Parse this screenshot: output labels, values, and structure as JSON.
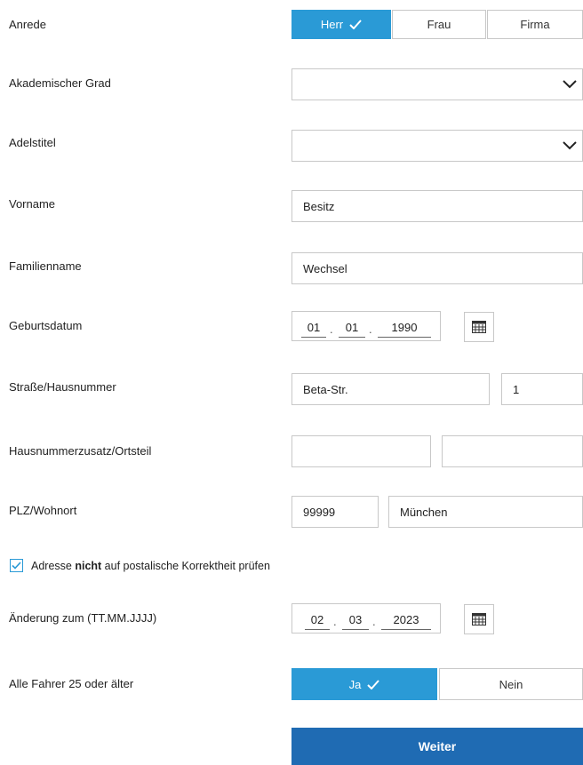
{
  "form": {
    "anrede": {
      "label": "Anrede",
      "options": [
        "Herr",
        "Frau",
        "Firma"
      ],
      "selected": "Herr"
    },
    "akademischer_grad": {
      "label": "Akademischer Grad",
      "value": ""
    },
    "adelstitel": {
      "label": "Adelstitel",
      "value": ""
    },
    "vorname": {
      "label": "Vorname",
      "value": "Besitz"
    },
    "familienname": {
      "label": "Familienname",
      "value": "Wechsel"
    },
    "geburtsdatum": {
      "label": "Geburtsdatum",
      "day": "01",
      "month": "01",
      "year": "1990",
      "separator": "."
    },
    "strasse": {
      "label": "Straße/Hausnummer",
      "street": "Beta-Str.",
      "number": "1"
    },
    "zusatz": {
      "label": "Hausnummerzusatz/Ortsteil",
      "zusatz": "",
      "ortsteil": ""
    },
    "plz": {
      "label": "PLZ/Wohnort",
      "plz": "99999",
      "ort": "München"
    },
    "adresse_check": {
      "text_before": "Adresse ",
      "text_bold": "nicht",
      "text_after": " auf postalische Korrektheit prüfen",
      "checked": true
    },
    "aenderung": {
      "label": "Änderung zum (TT.MM.JJJJ)",
      "day": "02",
      "month": "03",
      "year": "2023",
      "separator": "."
    },
    "alle_fahrer": {
      "label": "Alle Fahrer 25 oder älter",
      "options": [
        "Ja",
        "Nein"
      ],
      "selected": "Ja"
    },
    "submit_label": "Weiter"
  },
  "icons": {
    "check": "checkmark-icon",
    "chevron": "chevron-down-icon",
    "calendar": "calendar-icon"
  },
  "colors": {
    "accent": "#2a9ad6",
    "primary_button": "#1f6bb3",
    "border": "#c8c8c8"
  }
}
